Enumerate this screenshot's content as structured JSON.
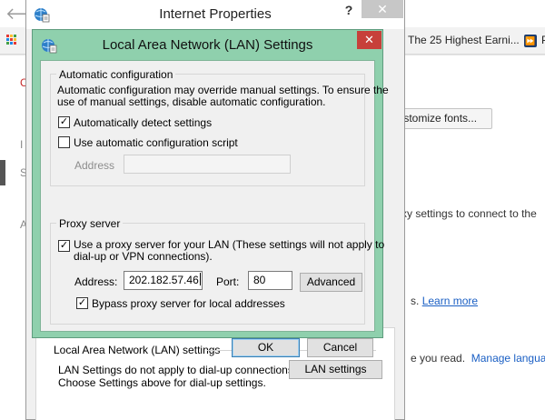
{
  "browser": {
    "bookmarks": [
      "The 25 Highest Earni..."
    ],
    "page": {
      "button_label": "ıstomize fonts...",
      "proxy_text": "xy settings to connect to the",
      "learn_more_prefix": "s.",
      "learn_more_link": "Learn more",
      "language_prefix": "e you read.",
      "language_link": "Manage languag"
    }
  },
  "internet_properties": {
    "title": "Internet Properties",
    "help_label": "?",
    "close_label": "✕",
    "lan_group_label": "Local Area Network (LAN) settings",
    "lan_note": [
      "LAN Settings do not apply to dial-up connections.",
      "Choose Settings above for dial-up settings."
    ],
    "lan_settings_button": "LAN settings"
  },
  "lan_dialog": {
    "title": "Local Area Network (LAN) Settings",
    "close_label": "✕",
    "auto_config": {
      "group_label": "Automatic configuration",
      "description": [
        "Automatic configuration may override manual settings.  To ensure the",
        "use of manual settings, disable automatic configuration."
      ],
      "auto_detect_label": "Automatically detect settings",
      "auto_detect_checked": true,
      "script_label": "Use automatic configuration script",
      "script_checked": false,
      "address_label": "Address",
      "address_value": ""
    },
    "proxy": {
      "group_label": "Proxy server",
      "use_proxy_label": [
        "Use a proxy server for your LAN (These settings will not apply to",
        "dial-up or VPN connections)."
      ],
      "use_proxy_checked": true,
      "address_label": "Address:",
      "address_value": "202.182.57.46",
      "port_label": "Port:",
      "port_value": "80",
      "advanced_button": "Advanced",
      "bypass_label": "Bypass proxy server for local addresses",
      "bypass_checked": true
    },
    "ok_button": "OK",
    "cancel_button": "Cancel"
  },
  "colors": {
    "dialog_frame": "#8fd0ad",
    "close_red": "#c7403a",
    "link_blue": "#1a5fc4"
  },
  "check_glyph": "✓"
}
